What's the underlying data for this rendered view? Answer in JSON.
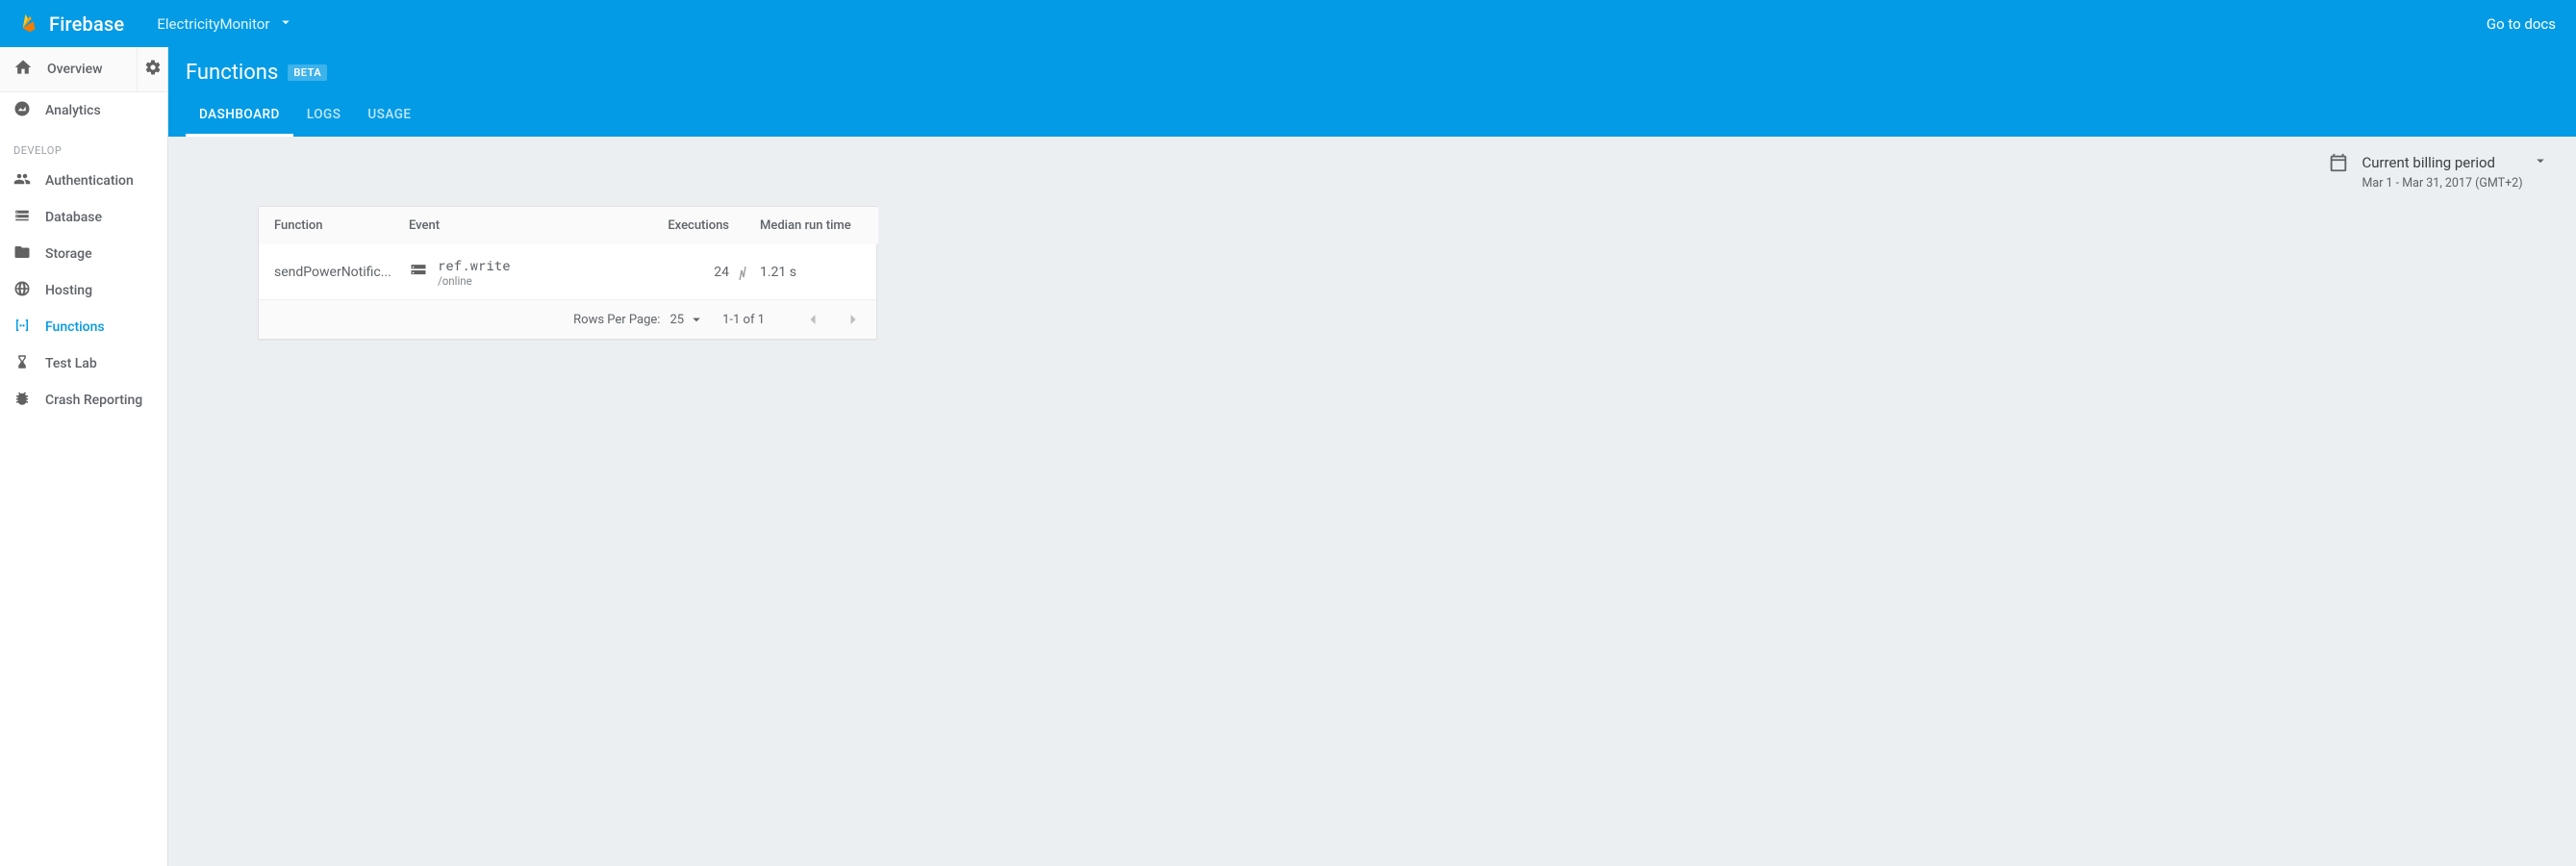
{
  "header": {
    "brand": "Firebase",
    "project_name": "ElectricityMonitor",
    "go_to_docs": "Go to docs"
  },
  "sidebar": {
    "overview_label": "Overview",
    "section_develop": "DEVELOP",
    "items": [
      {
        "name": "analytics",
        "label": "Analytics"
      },
      {
        "name": "auth",
        "label": "Authentication"
      },
      {
        "name": "database",
        "label": "Database"
      },
      {
        "name": "storage",
        "label": "Storage"
      },
      {
        "name": "hosting",
        "label": "Hosting"
      },
      {
        "name": "functions",
        "label": "Functions"
      },
      {
        "name": "testlab",
        "label": "Test Lab"
      },
      {
        "name": "crash",
        "label": "Crash Reporting"
      }
    ]
  },
  "page": {
    "title": "Functions",
    "badge": "BETA",
    "tabs": [
      {
        "label": "DASHBOARD",
        "active": true
      },
      {
        "label": "LOGS"
      },
      {
        "label": "USAGE"
      }
    ]
  },
  "billing": {
    "label": "Current billing period",
    "range": "Mar 1 - Mar 31, 2017 (GMT+2)"
  },
  "table": {
    "headers": {
      "function": "Function",
      "event": "Event",
      "executions": "Executions",
      "median": "Median run time"
    },
    "rows": [
      {
        "function": "sendPowerNotific...",
        "event_name": "ref.write",
        "event_path": "/online",
        "executions": "24",
        "median": "1.21 s"
      }
    ]
  },
  "footer": {
    "rows_per_page_label": "Rows Per Page:",
    "rows_per_page_value": "25",
    "range": "1-1 of 1"
  }
}
